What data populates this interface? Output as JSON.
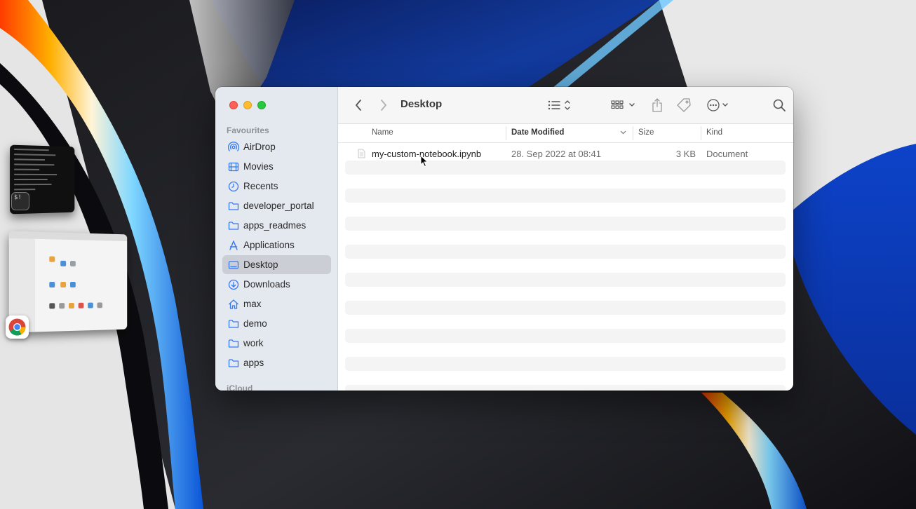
{
  "window": {
    "title": "Desktop"
  },
  "sidebar": {
    "favourites_heading": "Favourites",
    "icloud_heading": "iCloud",
    "items": [
      {
        "label": "AirDrop",
        "icon": "airdrop-icon"
      },
      {
        "label": "Movies",
        "icon": "film-icon"
      },
      {
        "label": "Recents",
        "icon": "clock-icon"
      },
      {
        "label": "developer_portal",
        "icon": "folder-icon"
      },
      {
        "label": "apps_readmes",
        "icon": "folder-icon"
      },
      {
        "label": "Applications",
        "icon": "applications-icon"
      },
      {
        "label": "Desktop",
        "icon": "desktop-icon",
        "selected": true
      },
      {
        "label": "Downloads",
        "icon": "download-icon"
      },
      {
        "label": "max",
        "icon": "home-icon"
      },
      {
        "label": "demo",
        "icon": "folder-icon"
      },
      {
        "label": "work",
        "icon": "folder-icon"
      },
      {
        "label": "apps",
        "icon": "folder-icon"
      }
    ]
  },
  "toolbar": {
    "back_icon": "chevron-left-icon",
    "forward_icon": "chevron-right-icon",
    "view_icon": "list-view-icon",
    "group_icon": "grid-group-icon",
    "share_icon": "share-icon",
    "tag_icon": "tag-icon",
    "more_icon": "ellipsis-circle-icon",
    "search_icon": "search-icon"
  },
  "list": {
    "columns": {
      "name": "Name",
      "date_modified": "Date Modified",
      "size": "Size",
      "kind": "Kind"
    },
    "sort_column": "Date Modified",
    "files": [
      {
        "name": "my-custom-notebook.ipynb",
        "date_modified": "28. Sep 2022 at 08:41",
        "size": "3 KB",
        "kind": "Document"
      }
    ]
  },
  "colors": {
    "close": "#ff5f57",
    "minimize": "#febc2e",
    "maximize": "#28c840",
    "sidebar_icon_blue": "#3478f6"
  }
}
